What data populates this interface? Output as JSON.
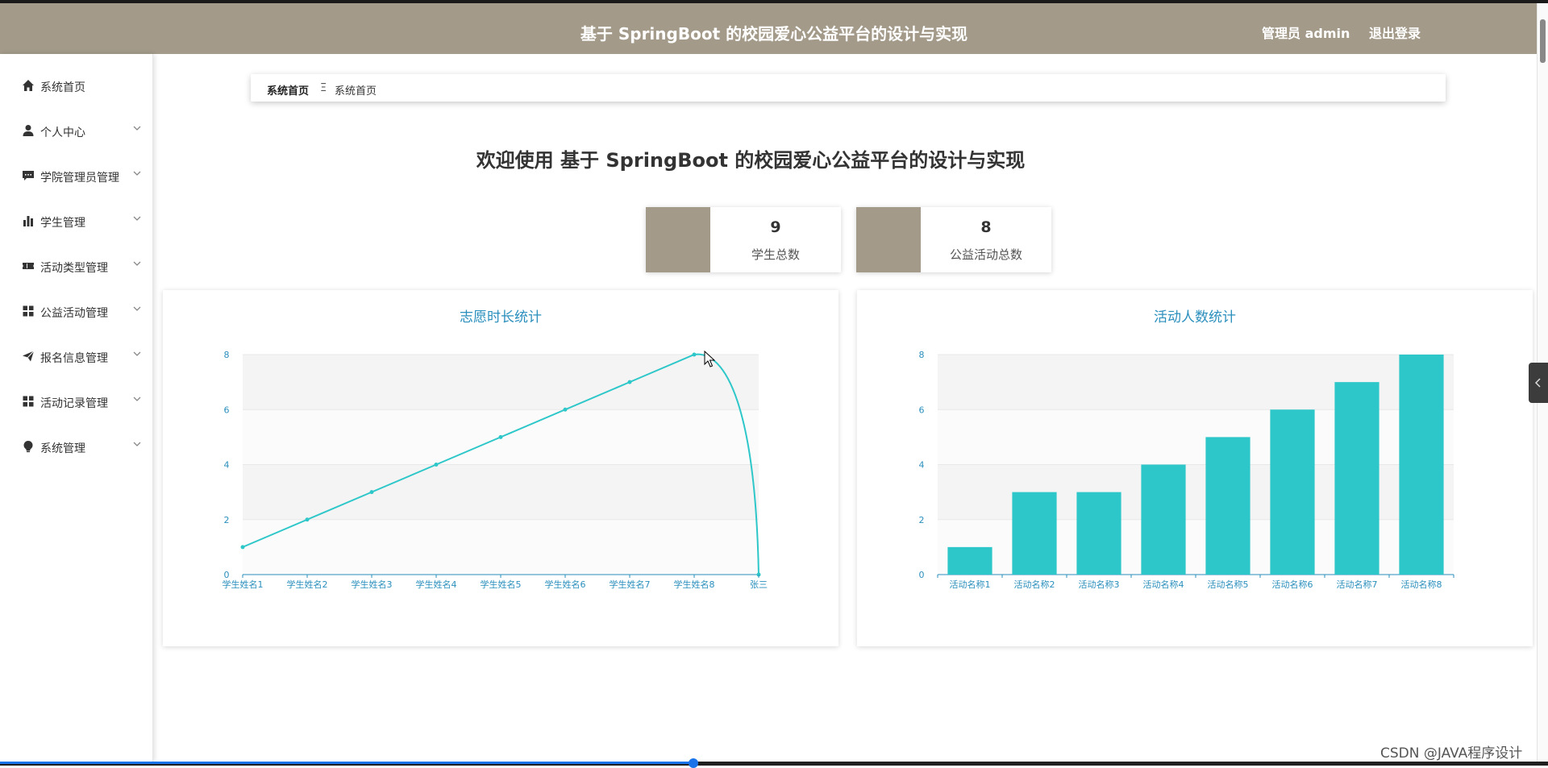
{
  "header": {
    "title": "基于 SpringBoot 的校园爱心公益平台的设计与实现",
    "user_label": "管理员 admin",
    "logout_label": "退出登录"
  },
  "sidebar": {
    "items": [
      {
        "label": "系统首页",
        "icon": "home-icon",
        "has_submenu": false
      },
      {
        "label": "个人中心",
        "icon": "user-icon",
        "has_submenu": true
      },
      {
        "label": "学院管理员管理",
        "icon": "message-icon",
        "has_submenu": true
      },
      {
        "label": "学生管理",
        "icon": "bar-chart-icon",
        "has_submenu": true
      },
      {
        "label": "活动类型管理",
        "icon": "ticket-icon",
        "has_submenu": true
      },
      {
        "label": "公益活动管理",
        "icon": "grid-icon",
        "has_submenu": true
      },
      {
        "label": "报名信息管理",
        "icon": "send-icon",
        "has_submenu": true
      },
      {
        "label": "活动记录管理",
        "icon": "grid-icon",
        "has_submenu": true
      },
      {
        "label": "系统管理",
        "icon": "bulb-icon",
        "has_submenu": true
      }
    ]
  },
  "breadcrumb": {
    "root": "系统首页",
    "separator": "Ξ",
    "current": "系统首页"
  },
  "welcome": "欢迎使用 基于 SpringBoot 的校园爱心公益平台的设计与实现",
  "stats": [
    {
      "value": "9",
      "label": "学生总数"
    },
    {
      "value": "8",
      "label": "公益活动总数"
    }
  ],
  "colors": {
    "brand": "#a39a89",
    "series": "#2ec7c9",
    "axis_text": "#2a8fbd",
    "chart_title": "#2a8fbd"
  },
  "chart_data": [
    {
      "type": "line",
      "title": "志愿时长统计",
      "categories": [
        "学生姓名1",
        "学生姓名2",
        "学生姓名3",
        "学生姓名4",
        "学生姓名5",
        "学生姓名6",
        "学生姓名7",
        "学生姓名8",
        "张三"
      ],
      "values": [
        1,
        2,
        3,
        4,
        5,
        6,
        7,
        8,
        0
      ],
      "ylim": [
        0,
        8
      ],
      "yticks": [
        0,
        2,
        4,
        6,
        8
      ],
      "smooth": true,
      "grid": true
    },
    {
      "type": "bar",
      "title": "活动人数统计",
      "categories": [
        "活动名称1",
        "活动名称2",
        "活动名称3",
        "活动名称4",
        "活动名称5",
        "活动名称6",
        "活动名称7",
        "活动名称8"
      ],
      "values": [
        1,
        3,
        3,
        4,
        5,
        6,
        7,
        8
      ],
      "ylim": [
        0,
        8
      ],
      "yticks": [
        0,
        2,
        4,
        6,
        8
      ],
      "grid": true
    }
  ],
  "watermark": "CSDN @JAVA程序设计"
}
